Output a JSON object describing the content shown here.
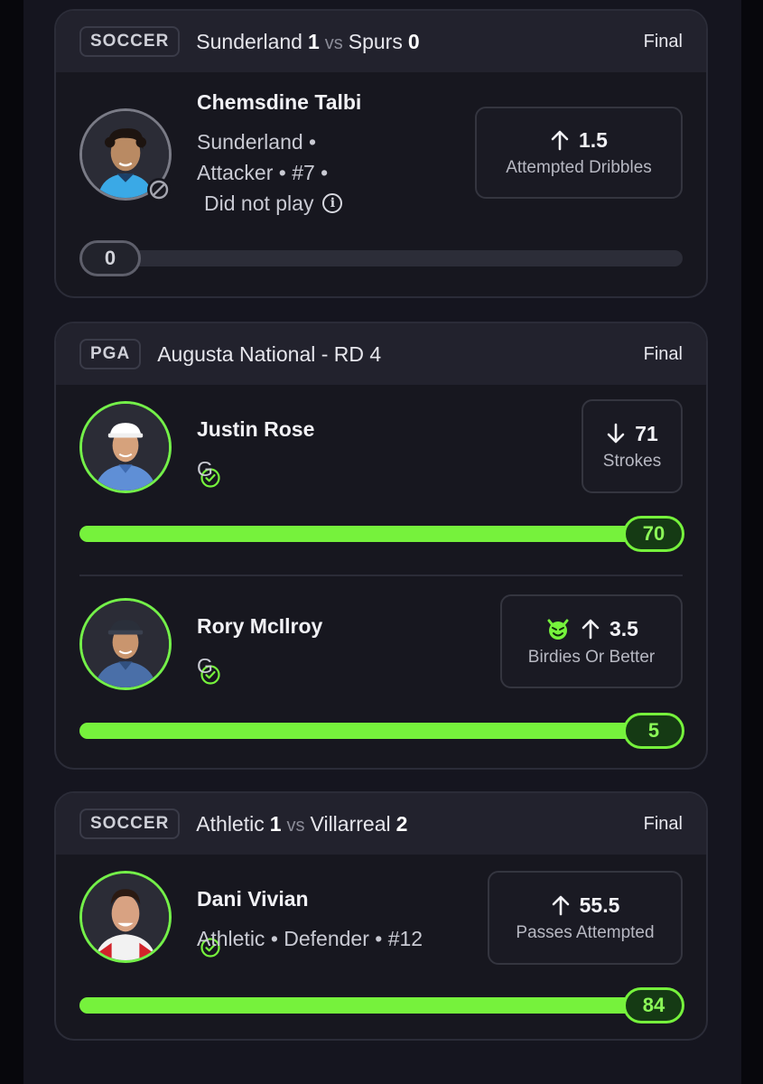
{
  "cards": [
    {
      "sport": "SOCCER",
      "home_team": "Sunderland",
      "home_score": "1",
      "vs": "vs",
      "away_team": "Spurs",
      "away_score": "0",
      "status": "Final",
      "picks": [
        {
          "player": "Chemsdine Talbi",
          "meta_line1": "Sunderland •",
          "meta_line2": "Attacker • #7 •",
          "meta_line3": "Did not play",
          "direction": "up",
          "line": "1.5",
          "stat": "Attempted Dribbles",
          "result": "0",
          "progress_fraction": 0.0,
          "avatar_status": "did-not-play",
          "colors": {
            "shirt": "#3aa9e6",
            "skin": "#b98a63",
            "hair": "#1d1410"
          }
        }
      ]
    },
    {
      "sport": "PGA",
      "event": "Augusta National - RD 4",
      "status": "Final",
      "picks": [
        {
          "player": "Justin Rose",
          "meta_line1": "G",
          "direction": "down",
          "line": "71",
          "stat": "Strokes",
          "result": "70",
          "progress_fraction": 1.0,
          "avatar_status": "won",
          "colors": {
            "shirt": "#5f8fd6",
            "skin": "#d6a27c",
            "hair": "#ffffff"
          }
        },
        {
          "player": "Rory McIlroy",
          "meta_line1": "G",
          "direction": "up",
          "line": "3.5",
          "stat": "Birdies Or Better",
          "result": "5",
          "progress_fraction": 1.0,
          "avatar_status": "won",
          "badge_icon": "demon-icon",
          "colors": {
            "shirt": "#4a6fa8",
            "skin": "#c9956e",
            "hair": "#2a2f3a"
          }
        }
      ]
    },
    {
      "sport": "SOCCER",
      "home_team": "Athletic",
      "home_score": "1",
      "vs": "vs",
      "away_team": "Villarreal",
      "away_score": "2",
      "status": "Final",
      "picks": [
        {
          "player": "Dani Vivian",
          "meta_line1": "Athletic • Defender • #12",
          "direction": "up",
          "line": "55.5",
          "stat": "Passes Attempted",
          "result": "84",
          "progress_fraction": 1.0,
          "avatar_status": "won",
          "colors": {
            "shirt": "#f2f2f2",
            "skin": "#d8a282",
            "hair": "#2b1a12"
          }
        }
      ]
    }
  ],
  "theme": {
    "accent": "#76f23c",
    "background": "#15151f",
    "card": "#17171f",
    "header": "#22222d"
  }
}
